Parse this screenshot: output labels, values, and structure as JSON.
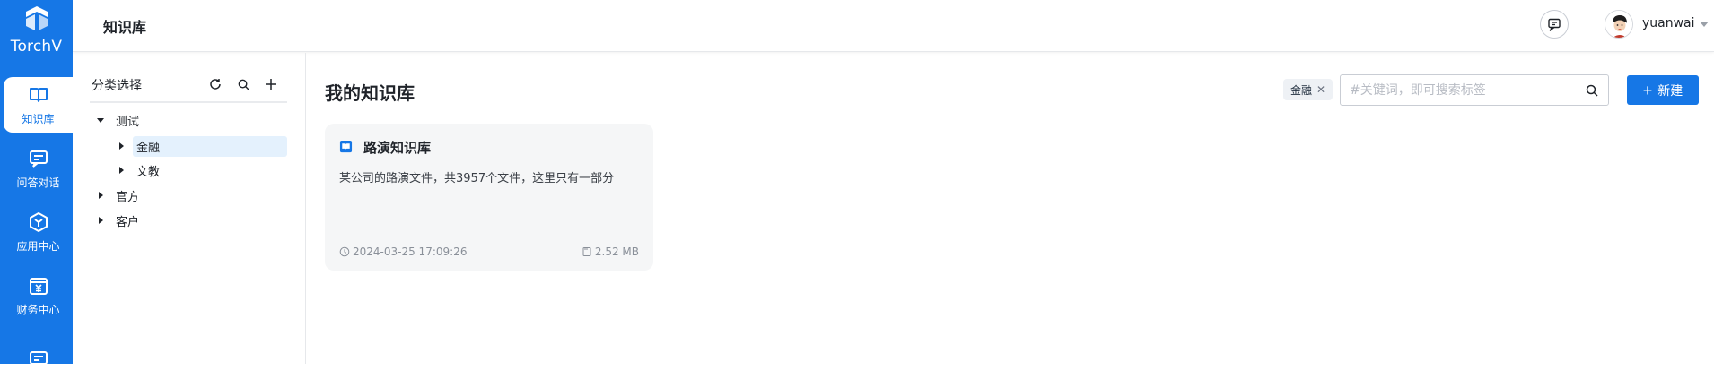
{
  "brand": {
    "name": "TorchV"
  },
  "nav": {
    "items": [
      {
        "label": "知识库",
        "icon": "book-icon",
        "active": true
      },
      {
        "label": "问答对话",
        "icon": "chat-icon",
        "active": false
      },
      {
        "label": "应用中心",
        "icon": "hexagon-app-icon",
        "active": false
      },
      {
        "label": "财务中心",
        "icon": "finance-icon",
        "active": false
      },
      {
        "label": "",
        "icon": "chat-icon",
        "active": false
      }
    ]
  },
  "header": {
    "title": "知识库",
    "user": {
      "name": "yuanwai"
    }
  },
  "category": {
    "title": "分类选择",
    "tree": [
      {
        "label": "测试",
        "expanded": true,
        "children": [
          {
            "label": "金融",
            "selected": true
          },
          {
            "label": "文教",
            "selected": false
          }
        ]
      },
      {
        "label": "官方",
        "expanded": false
      },
      {
        "label": "客户",
        "expanded": false
      }
    ]
  },
  "main": {
    "title": "我的知识库",
    "active_tag": "金融",
    "search": {
      "placeholder": "#关键词，即可搜索标签",
      "value": ""
    },
    "new_button": "新建",
    "cards": [
      {
        "title": "路演知识库",
        "description": "某公司的路演文件，共3957个文件，这里只有一部分",
        "time": "2024-03-25 17:09:26",
        "size": "2.52 MB"
      }
    ]
  },
  "colors": {
    "primary": "#1677e6",
    "selected_bg": "#e4f1fd",
    "card_bg": "#f5f6f7"
  }
}
